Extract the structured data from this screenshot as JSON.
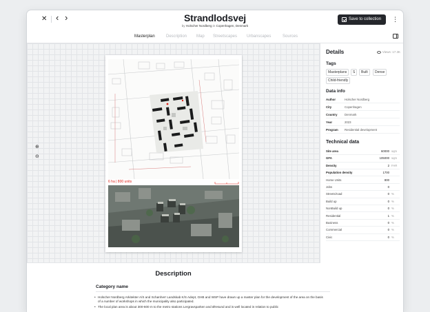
{
  "header": {
    "close_glyph": "✕",
    "back_glyph": "‹",
    "forward_glyph": "›",
    "title": "Strandlodsvej",
    "by_label": "by",
    "architect": "Holscher Nordberg",
    "in_label": "in",
    "location": "Copenhagen, Denmark",
    "save_label": "Save to collection",
    "more_glyph": "⋮"
  },
  "tabs": [
    {
      "label": "Masterplan",
      "active": true
    },
    {
      "label": "Description",
      "active": false
    },
    {
      "label": "Map",
      "active": false
    },
    {
      "label": "Streetscapes",
      "active": false
    },
    {
      "label": "Urbanscapes",
      "active": false
    },
    {
      "label": "Sources",
      "active": false
    }
  ],
  "canvas": {
    "zoom_in_glyph": "⊕",
    "zoom_out_glyph": "⊖",
    "plan_units_label": "6 ha | 800 units"
  },
  "panel": {
    "title": "Details",
    "views": "Views: 17.3K",
    "tags_heading": "Tags",
    "tags": [
      "Masterplans",
      "S",
      "Built",
      "Dense",
      "Child-friendly"
    ],
    "data_info_heading": "Data info",
    "data_info": [
      {
        "key": "Author",
        "value": "Holscher Nordberg"
      },
      {
        "key": "City",
        "value": "Copenhagen"
      },
      {
        "key": "Country",
        "value": "Denmark"
      },
      {
        "key": "Year",
        "value": "2023"
      },
      {
        "key": "Program",
        "value": "Residential development"
      }
    ],
    "technical_heading": "Technical data",
    "technical": [
      {
        "key": "Site area",
        "value": "60000",
        "unit": "sqm",
        "bold": true
      },
      {
        "key": "GFA",
        "value": "105000",
        "unit": "sqm",
        "bold": true
      },
      {
        "key": "Density",
        "value": "2",
        "unit": "FAR",
        "bold": true
      },
      {
        "key": "Population density",
        "value": "1700",
        "unit": "",
        "bold": true
      },
      {
        "key": "Home Units",
        "value": "800",
        "unit": "",
        "bold": false
      },
      {
        "key": "Jobs",
        "value": "0",
        "unit": "",
        "bold": false
      },
      {
        "key": "Streets/road",
        "value": "0",
        "unit": "%",
        "bold": false
      },
      {
        "key": "Build up",
        "value": "0",
        "unit": "%",
        "bold": false
      },
      {
        "key": "NonBuild up",
        "value": "0",
        "unit": "%",
        "bold": false
      },
      {
        "key": "Residential",
        "value": "1",
        "unit": "%",
        "bold": false
      },
      {
        "key": "Business",
        "value": "0",
        "unit": "%",
        "bold": false
      },
      {
        "key": "Commercial",
        "value": "0",
        "unit": "%",
        "bold": false
      },
      {
        "key": "Civic",
        "value": "0",
        "unit": "%",
        "bold": false
      }
    ]
  },
  "description": {
    "title": "Description",
    "category": "Category name",
    "bullets": [
      "Holscher Nordberg Arkitekter A/S and Schønherr Landskab K/S Adept, GHB and WSP have drawn up a master plan for the development of the area on the basis of a number of workshops in which the municipality also participated.",
      "The local plan area is about 300-600 m to the metro stations Lergravsparken and Øresund and is well located in relation to public"
    ]
  },
  "colors": {
    "accent_dark": "#25272c",
    "units_red": "#e0261d"
  }
}
